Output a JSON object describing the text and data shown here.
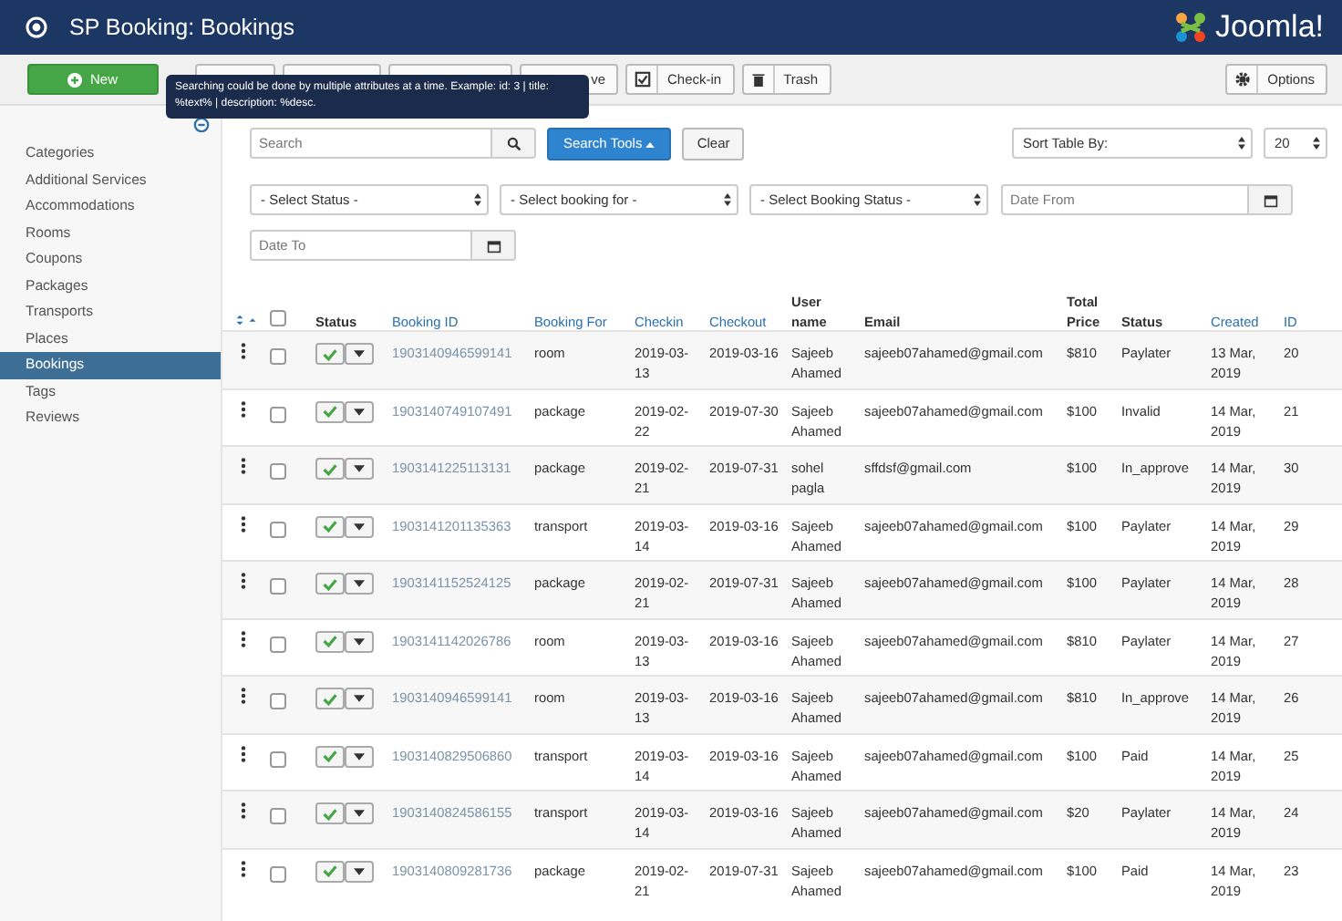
{
  "header": {
    "title": "SP Booking: Bookings",
    "brand": "Joomla!"
  },
  "toolbar": {
    "buttons": [
      {
        "kind": "new",
        "label": "New"
      },
      {
        "kind": "covered"
      },
      {
        "kind": "covered"
      },
      {
        "kind": "covered"
      },
      {
        "kind": "partial",
        "label": "ve"
      },
      {
        "kind": "checkin",
        "label": "Check-in"
      },
      {
        "kind": "trash",
        "label": "Trash"
      }
    ],
    "options": "Options"
  },
  "tooltip": {
    "text": "Searching could be done by multiple attributes at a time. Example: id: 3 | title: %text% | description: %desc."
  },
  "sidebar": {
    "items": [
      {
        "label": "Categories",
        "selected": false
      },
      {
        "label": "Additional Services",
        "selected": false
      },
      {
        "label": "Accommodations",
        "selected": false
      },
      {
        "label": "Rooms",
        "selected": false
      },
      {
        "label": "Coupons",
        "selected": false
      },
      {
        "label": "Packages",
        "selected": false
      },
      {
        "label": "Transports",
        "selected": false
      },
      {
        "label": "Places",
        "selected": false
      },
      {
        "label": "Bookings",
        "selected": true
      },
      {
        "label": "Tags",
        "selected": false
      },
      {
        "label": "Reviews",
        "selected": false
      }
    ]
  },
  "search": {
    "placeholder": "Search",
    "tools": "Search Tools",
    "clear": "Clear",
    "sort": "Sort Table By:",
    "limit": "20"
  },
  "filters": {
    "selects": [
      "- Select Status -",
      "- Select booking for -",
      "- Select Booking Status -"
    ],
    "date_from": {
      "placeholder": "Date From"
    },
    "date_to": {
      "placeholder": "Date To"
    }
  },
  "table": {
    "select_all_checked": false,
    "columns": [
      {
        "label": "Status",
        "sortable": false
      },
      {
        "label": "Booking ID",
        "sortable": true
      },
      {
        "label": "Booking For",
        "sortable": true
      },
      {
        "label": "Checkin",
        "sortable": true
      },
      {
        "label": "Checkout",
        "sortable": true
      },
      {
        "label": "User name",
        "sortable": false
      },
      {
        "label": "Email",
        "sortable": false
      },
      {
        "label": "Total Price",
        "sortable": false
      },
      {
        "label": "Status",
        "sortable": false
      },
      {
        "label": "Created",
        "sortable": true
      },
      {
        "label": "ID",
        "sortable": true
      }
    ],
    "rows": [
      {
        "published": true,
        "booking_id": "1903140946599141",
        "booking_for": "room",
        "checkin": "2019-03-13",
        "checkout": "2019-03-16",
        "user": "Sajeeb Ahamed",
        "email": "sajeeb07ahamed@gmail.com",
        "price": "$810",
        "status": "Paylater",
        "created": "13 Mar, 2019",
        "id": "20",
        "checked": false
      },
      {
        "published": true,
        "booking_id": "1903140749107491",
        "booking_for": "package",
        "checkin": "2019-02-22",
        "checkout": "2019-07-30",
        "user": "Sajeeb Ahamed",
        "email": "sajeeb07ahamed@gmail.com",
        "price": "$100",
        "status": "Invalid",
        "created": "14 Mar, 2019",
        "id": "21",
        "checked": false
      },
      {
        "published": true,
        "booking_id": "1903141225113131",
        "booking_for": "package",
        "checkin": "2019-02-21",
        "checkout": "2019-07-31",
        "user": "sohel pagla",
        "email": "sffdsf@gmail.com",
        "price": "$100",
        "status": "In_approve",
        "created": "14 Mar, 2019",
        "id": "30",
        "checked": false
      },
      {
        "published": true,
        "booking_id": "1903141201135363",
        "booking_for": "transport",
        "checkin": "2019-03-14",
        "checkout": "2019-03-16",
        "user": "Sajeeb Ahamed",
        "email": "sajeeb07ahamed@gmail.com",
        "price": "$100",
        "status": "Paylater",
        "created": "14 Mar, 2019",
        "id": "29",
        "checked": false
      },
      {
        "published": true,
        "booking_id": "1903141152524125",
        "booking_for": "package",
        "checkin": "2019-02-21",
        "checkout": "2019-07-31",
        "user": "Sajeeb Ahamed",
        "email": "sajeeb07ahamed@gmail.com",
        "price": "$100",
        "status": "Paylater",
        "created": "14 Mar, 2019",
        "id": "28",
        "checked": false
      },
      {
        "published": true,
        "booking_id": "1903141142026786",
        "booking_for": "room",
        "checkin": "2019-03-13",
        "checkout": "2019-03-16",
        "user": "Sajeeb Ahamed",
        "email": "sajeeb07ahamed@gmail.com",
        "price": "$810",
        "status": "Paylater",
        "created": "14 Mar, 2019",
        "id": "27",
        "checked": false
      },
      {
        "published": true,
        "booking_id": "1903140946599141",
        "booking_for": "room",
        "checkin": "2019-03-13",
        "checkout": "2019-03-16",
        "user": "Sajeeb Ahamed",
        "email": "sajeeb07ahamed@gmail.com",
        "price": "$810",
        "status": "In_approve",
        "created": "14 Mar, 2019",
        "id": "26",
        "checked": false
      },
      {
        "published": true,
        "booking_id": "1903140829506860",
        "booking_for": "transport",
        "checkin": "2019-03-14",
        "checkout": "2019-03-16",
        "user": "Sajeeb Ahamed",
        "email": "sajeeb07ahamed@gmail.com",
        "price": "$100",
        "status": "Paid",
        "created": "14 Mar, 2019",
        "id": "25",
        "checked": false
      },
      {
        "published": true,
        "booking_id": "1903140824586155",
        "booking_for": "transport",
        "checkin": "2019-03-14",
        "checkout": "2019-03-16",
        "user": "Sajeeb Ahamed",
        "email": "sajeeb07ahamed@gmail.com",
        "price": "$20",
        "status": "Paylater",
        "created": "14 Mar, 2019",
        "id": "24",
        "checked": false
      },
      {
        "published": true,
        "booking_id": "1903140809281736",
        "booking_for": "package",
        "checkin": "2019-02-21",
        "checkout": "2019-07-31",
        "user": "Sajeeb Ahamed",
        "email": "sajeeb07ahamed@gmail.com",
        "price": "$100",
        "status": "Paid",
        "created": "14 Mar, 2019",
        "id": "23",
        "checked": false
      }
    ]
  }
}
